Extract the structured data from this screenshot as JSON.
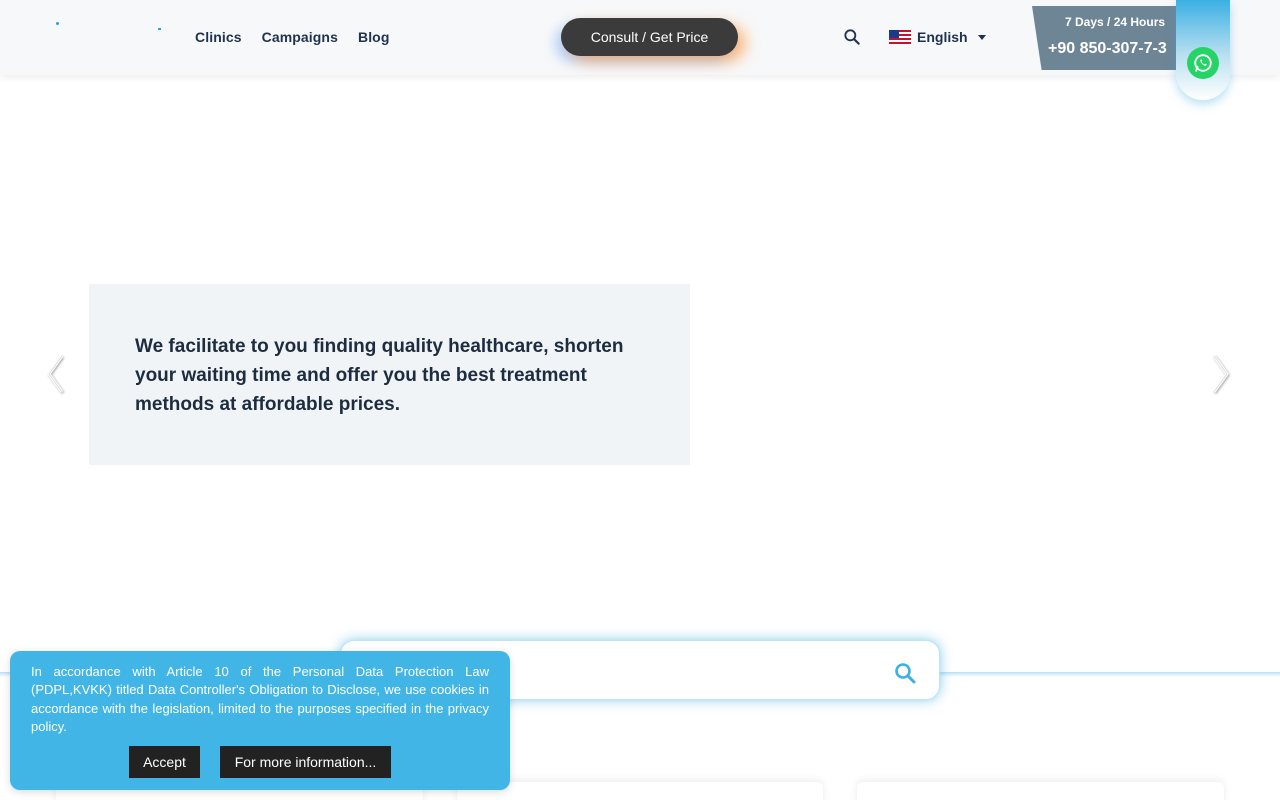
{
  "header": {
    "nav": [
      "Clinics",
      "Campaigns",
      "Blog"
    ],
    "consult_label": "Consult / Get Price",
    "language": "English",
    "phone_hours": "7 Days / 24 Hours",
    "phone_number": "+90 850-307-7-3"
  },
  "hero": {
    "text": "We facilitate to you finding quality healthcare, shorten your waiting time and offer you the best treatment methods at affordable prices."
  },
  "search": {
    "placeholder": ""
  },
  "cookie": {
    "text": "In accordance with Article 10 of the Personal Data Protection Law (PDPL,KVKK) titled Data Controller's Obligation to Disclose, we use cookies in accordance with the legislation, limited to the purposes specified in the privacy policy.",
    "accept_label": "Accept",
    "more_label": "For more information..."
  },
  "colors": {
    "brand": "#27a3dd",
    "cookie_bg": "#41b6e6",
    "whatsapp": "#25d366",
    "consult_bg": "#3b3b3b"
  },
  "icons": [
    "search-icon",
    "us-flag-icon",
    "caret-down-icon",
    "whatsapp-icon",
    "chevron-left-icon",
    "chevron-right-icon"
  ]
}
